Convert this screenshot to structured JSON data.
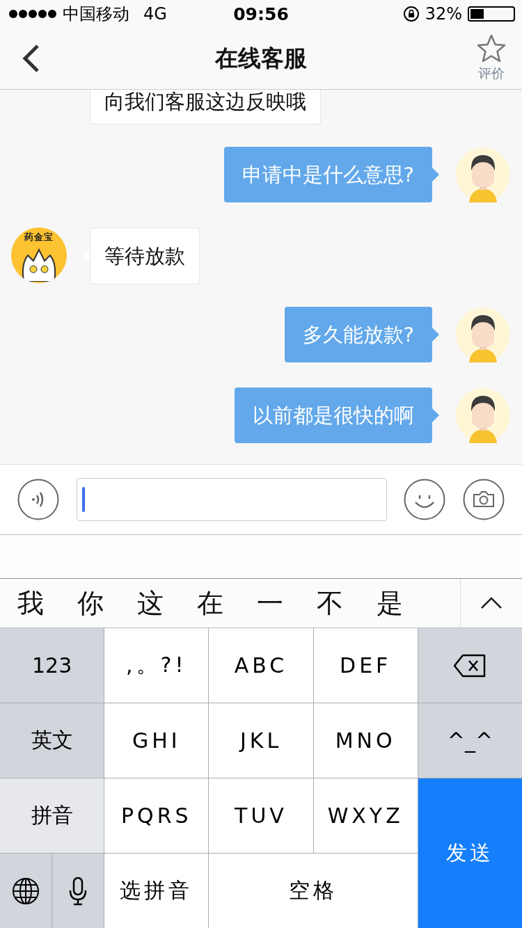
{
  "status_bar": {
    "carrier": "中国移动",
    "network": "4G",
    "time": "09:56",
    "battery_text": "32%"
  },
  "nav": {
    "title": "在线客服",
    "rate_label": "评价"
  },
  "messages": [
    {
      "kind": "bot",
      "text": "向我们客服这边反映哦",
      "avatar_visible": false
    },
    {
      "kind": "user",
      "text": "申请中是什么意思?",
      "avatar_visible": true
    },
    {
      "kind": "bot",
      "text": "等待放款",
      "avatar_visible": true
    },
    {
      "kind": "user",
      "text": "多久能放款?",
      "avatar_visible": true
    },
    {
      "kind": "user",
      "text": "以前都是很快的啊",
      "avatar_visible": true
    }
  ],
  "bot_avatar_label": "药金宝",
  "candidates": [
    "我",
    "你",
    "这",
    "在",
    "一",
    "不",
    "是"
  ],
  "keys": [
    {
      "kind": "func",
      "label": "123",
      "selected": false
    },
    {
      "kind": "char",
      "label": ",。?!"
    },
    {
      "kind": "char",
      "label": "ABC"
    },
    {
      "kind": "char",
      "label": "DEF"
    },
    {
      "kind": "backspace"
    },
    {
      "kind": "func",
      "label": "英文",
      "selected": false
    },
    {
      "kind": "char",
      "label": "GHI"
    },
    {
      "kind": "char",
      "label": "JKL"
    },
    {
      "kind": "char",
      "label": "MNO"
    },
    {
      "kind": "func",
      "label": "^_^",
      "selected": false
    },
    {
      "kind": "func",
      "label": "拼音",
      "selected": true
    },
    {
      "kind": "char",
      "label": "PQRS"
    },
    {
      "kind": "char",
      "label": "TUV"
    },
    {
      "kind": "char",
      "label": "WXYZ"
    },
    {
      "kind": "send",
      "label": "发送"
    },
    {
      "kind": "globe-mic"
    },
    {
      "kind": "char",
      "label": "选拼音"
    },
    {
      "kind": "space",
      "label": "空格"
    }
  ]
}
